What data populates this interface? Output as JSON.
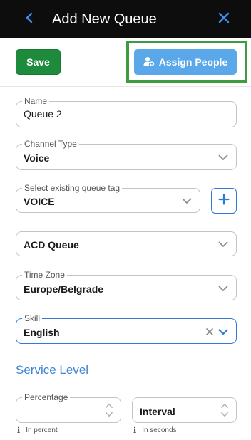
{
  "header": {
    "title": "Add New Queue"
  },
  "toolbar": {
    "save_label": "Save",
    "assign_label": "Assign People"
  },
  "form": {
    "name": {
      "label": "Name",
      "value": "Queue 2"
    },
    "channel_type": {
      "label": "Channel Type",
      "value": "Voice"
    },
    "queue_tag": {
      "label": "Select existing queue tag",
      "value": "VOICE"
    },
    "queue_kind": {
      "value": "ACD Queue"
    },
    "time_zone": {
      "label": "Time Zone",
      "value": "Europe/Belgrade"
    },
    "skill": {
      "label": "Skill",
      "value": "English"
    }
  },
  "service_level": {
    "title": "Service Level",
    "percentage": {
      "label": "Percentage",
      "value": "",
      "hint": "In percent"
    },
    "interval": {
      "value": "Interval",
      "hint": "In seconds"
    }
  },
  "colors": {
    "header_bg": "#0d0d0d",
    "accent_blue": "#2f7ad4",
    "save_green": "#1e8a3c",
    "assign_blue": "#5aa8ea",
    "highlight_green": "#3f9b3f"
  },
  "icons": {
    "back": "chevron-left-icon",
    "close": "close-icon",
    "assign": "person-add-icon",
    "dropdown": "chevron-down-icon",
    "clear": "clear-icon",
    "add": "plus-icon",
    "spinner": "spinner-arrows-icon",
    "info": "info-icon"
  }
}
